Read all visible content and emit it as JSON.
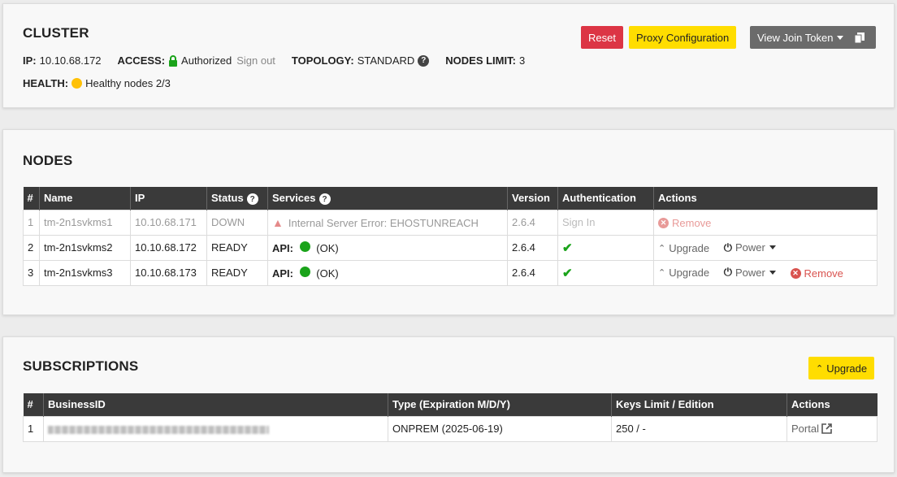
{
  "cluster": {
    "title": "CLUSTER",
    "ip_label": "IP:",
    "ip_value": "10.10.68.172",
    "access_label": "ACCESS:",
    "access_value": "Authorized",
    "sign_out": "Sign out",
    "topology_label": "TOPOLOGY:",
    "topology_value": "STANDARD",
    "nodes_limit_label": "NODES LIMIT:",
    "nodes_limit_value": "3",
    "health_label": "HEALTH:",
    "health_value": "Healthy nodes 2/3",
    "health_color": "#ffc107",
    "buttons": {
      "reset": "Reset",
      "proxy": "Proxy Configuration",
      "join_token": "View Join Token"
    }
  },
  "nodes": {
    "title": "NODES",
    "headers": [
      "#",
      "Name",
      "IP",
      "Status",
      "Services",
      "Version",
      "Authentication",
      "Actions"
    ],
    "rows": [
      {
        "num": "1",
        "name": "tm-2n1svkms1",
        "ip": "10.10.68.171",
        "status": "DOWN",
        "service_error": "Internal Server Error: EHOSTUNREACH",
        "version": "2.6.4",
        "auth": "Sign In",
        "remove": "Remove"
      },
      {
        "num": "2",
        "name": "tm-2n1svkms2",
        "ip": "10.10.68.172",
        "status": "READY",
        "api_label": "API:",
        "api_status": "(OK)",
        "version": "2.6.4",
        "upgrade": "Upgrade",
        "power": "Power"
      },
      {
        "num": "3",
        "name": "tm-2n1svkms3",
        "ip": "10.10.68.173",
        "status": "READY",
        "api_label": "API:",
        "api_status": "(OK)",
        "version": "2.6.4",
        "upgrade": "Upgrade",
        "power": "Power",
        "remove": "Remove"
      }
    ]
  },
  "subscriptions": {
    "title": "SUBSCRIPTIONS",
    "upgrade_button": "Upgrade",
    "headers": [
      "#",
      "BusinessID",
      "Type (Expiration M/D/Y)",
      "Keys Limit / Edition",
      "Actions"
    ],
    "rows": [
      {
        "num": "1",
        "type": "ONPREM (2025-06-19)",
        "keys": "250 / -",
        "action": "Portal"
      }
    ]
  },
  "colors": {
    "ok_green": "#1aa31a",
    "danger": "#dc3545",
    "warning_yellow": "#ffdd00",
    "header_dark": "#3a3a3a"
  }
}
